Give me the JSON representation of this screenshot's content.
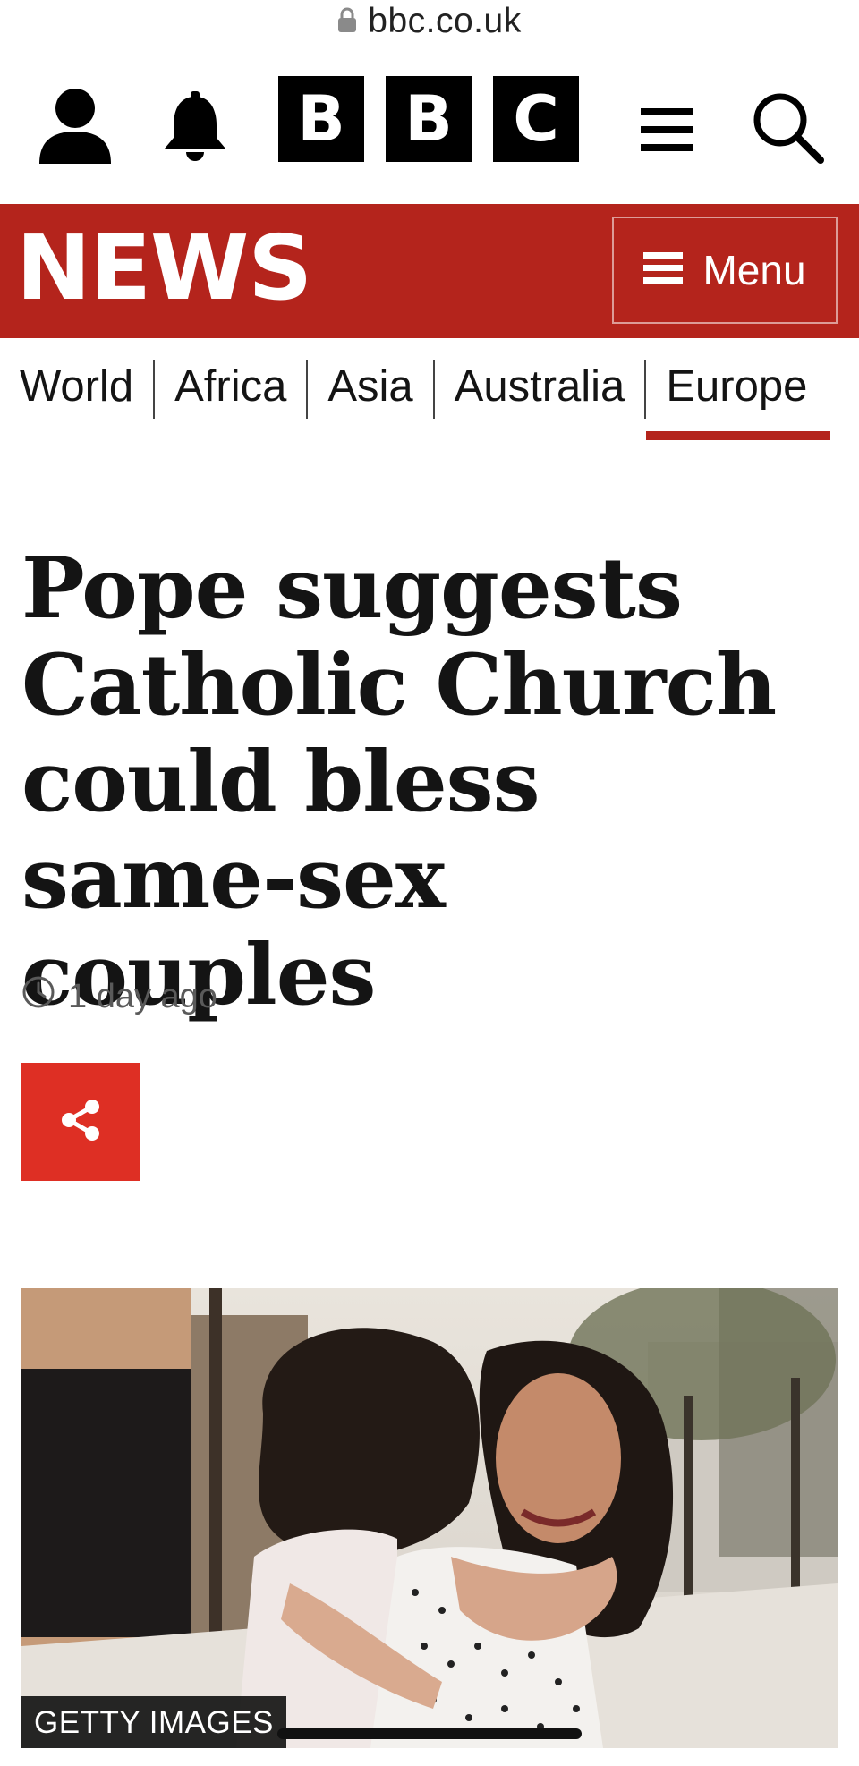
{
  "browser": {
    "url": "bbc.co.uk",
    "lock_icon": "lock-icon"
  },
  "bbc_header": {
    "logo_letters": [
      "B",
      "B",
      "C"
    ],
    "account_icon": "user-icon",
    "notifications_icon": "bell-icon",
    "menu_icon": "hamburger-icon",
    "search_icon": "search-icon"
  },
  "news_bar": {
    "logo": "NEWS",
    "menu_label": "Menu",
    "color": "#b4241c"
  },
  "sections": {
    "items": [
      "World",
      "Africa",
      "Asia",
      "Australia",
      "Europe"
    ],
    "active": "Europe"
  },
  "article": {
    "headline": "Pope suggests Catholic Church could bless same-sex couples",
    "timestamp": "1 day ago",
    "share_icon": "share-icon",
    "share_color": "#de2f24",
    "image_credit": "GETTY IMAGES"
  }
}
